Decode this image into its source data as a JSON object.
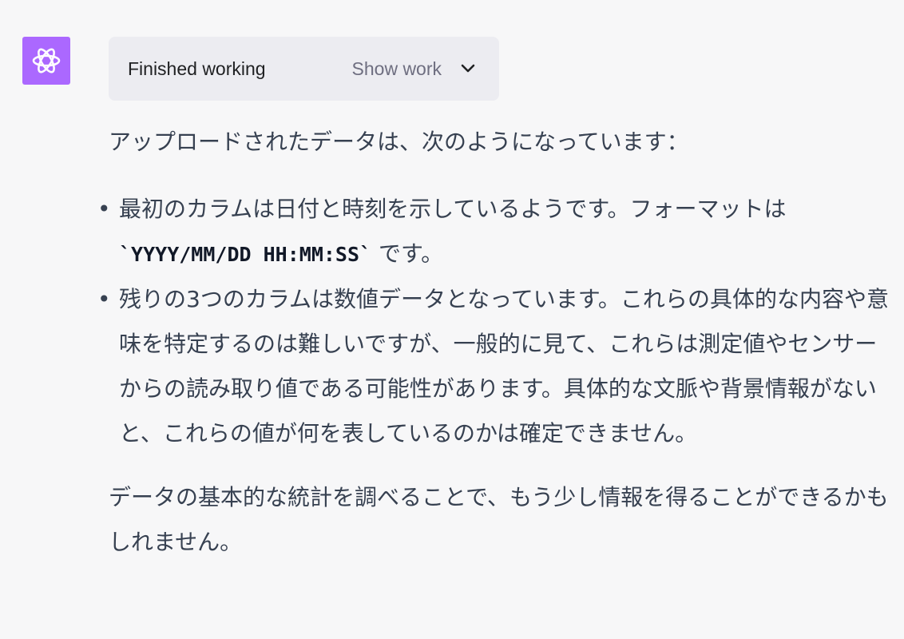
{
  "assistant": {
    "avatar_icon": "openai-logo-icon",
    "avatar_color": "#ab68ff"
  },
  "work_panel": {
    "status": "Finished working",
    "toggle_label": "Show work",
    "toggle_icon": "chevron-down-icon"
  },
  "message": {
    "intro": "アップロードされたデータは、次のようになっています：",
    "bullets": [
      {
        "text_before": "最初のカラムは日付と時刻を示しているようです。フォーマットは",
        "code": "`YYYY/MM/DD HH:MM:SS`",
        "text_after": " です。"
      },
      {
        "text": "残りの3つのカラムは数値データとなっています。これらの具体的な内容や意味を特定するのは難しいですが、一般的に見て、これらは測定値やセンサーからの読み取り値である可能性があります。具体的な文脈や背景情報がないと、これらの値が何を表しているのかは確定できません。"
      }
    ],
    "closing": "データの基本的な統計を調べることで、もう少し情報を得ることができるかもしれません。"
  }
}
